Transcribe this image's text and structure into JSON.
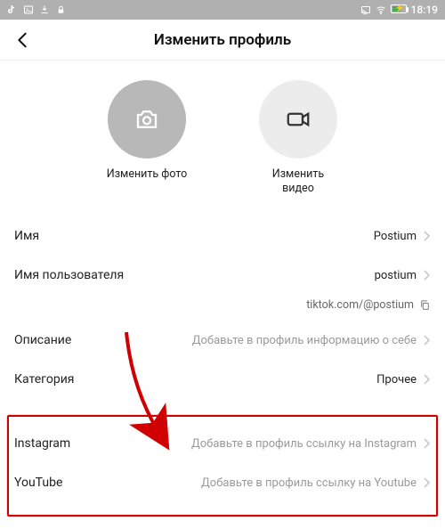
{
  "status": {
    "time": "18:19"
  },
  "header": {
    "title": "Изменить профиль"
  },
  "media": {
    "photo_label": "Изменить фото",
    "video_label": "Изменить\nвидео"
  },
  "rows": {
    "name": {
      "label": "Имя",
      "value": "Postium"
    },
    "username": {
      "label": "Имя пользователя",
      "value": "postium"
    },
    "url": {
      "value": "tiktok.com/@postium"
    },
    "bio": {
      "label": "Описание",
      "placeholder": "Добавьте в профиль информацию о себе"
    },
    "category": {
      "label": "Категория",
      "value": "Прочее"
    },
    "instagram": {
      "label": "Instagram",
      "placeholder": "Добавьте в профиль ссылку на Instagram"
    },
    "youtube": {
      "label": "YouTube",
      "placeholder": "Добавьте в профиль ссылку на Youtube"
    }
  }
}
